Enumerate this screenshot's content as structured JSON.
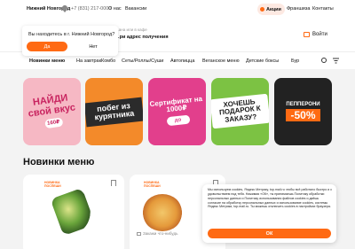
{
  "topbar": {
    "city": "Нижний Новгород",
    "phone": "+7 (831) 217-0000",
    "about": "О нас",
    "vacancies": "Вакансии",
    "promo": "Акции",
    "franchise": "Франшиза",
    "contacts": "Контакты"
  },
  "header": {
    "hint": "...ана или в кафе",
    "address": "...ри адрес получения",
    "login": "Войти"
  },
  "city_popup": {
    "question": "Вы находитесь в г. Нижний Новгород?",
    "yes": "Да",
    "no": "Нет"
  },
  "nav": {
    "items": [
      "Новинки меню",
      "На завтрак",
      "Комбо",
      "Сеты/Роллы/Суши",
      "Автопицца",
      "Веганское меню",
      "Детские боксы",
      "Бур"
    ]
  },
  "banners": [
    {
      "text": "НАЙДИ свой вкус",
      "badge": "160₽"
    },
    {
      "text": "побег из курятника"
    },
    {
      "text": "Сертификат на 1000₽",
      "badge": "до 1000₽"
    },
    {
      "text": "ХОЧЕШЬ ПОДАРОК К ЗАКАЗУ?"
    },
    {
      "text": "ПЕППЕРОНИ",
      "percent": "-50%"
    }
  ],
  "section_title": "Новинки меню",
  "cards": [
    {
      "tag": "НОВИНКА\nПОСПЕШИ"
    },
    {
      "tag": "НОВИНКА\nПОСПЕШИ",
      "note": "Закажи что-нибудь"
    }
  ],
  "cookie": {
    "text": "Мы используем cookies, Яндекс Метрику, top.mail.ru чтобы всё работало быстро и с удовольствием под тебя. Нажимая «ОК», ты принимаешь Политику обработки персональных данных и Политику использования файлов cookies и даёшь согласие на обработку персональных данных и использование cookies, системы Яндекс Метрики, top.mail.ru. Ты можешь отключить cookies в настройках браузера.",
    "ok": "ОК"
  },
  "colors": {
    "accent": "#ff6a13"
  }
}
